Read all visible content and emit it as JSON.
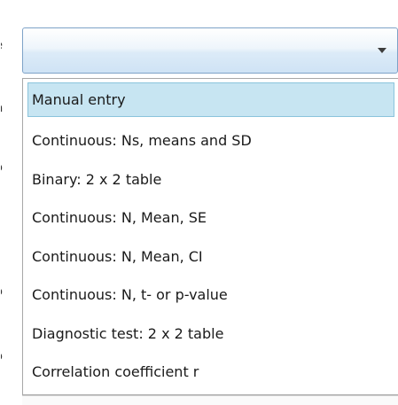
{
  "left_labels": [
    "e",
    "n",
    "o",
    "r",
    "o",
    "o"
  ],
  "combo": {
    "value": ""
  },
  "dropdown": {
    "options": [
      "Manual entry",
      "Continuous: Ns, means and SD",
      "Binary: 2 x 2 table",
      "Continuous: N, Mean, SE",
      "Continuous: N, Mean, CI",
      "Continuous: N, t- or p-value",
      "Diagnostic test: 2 x 2 table",
      "Correlation coefficient r"
    ],
    "selected_index": 0
  },
  "colors": {
    "highlight": "#c7e5f2",
    "highlight_border": "#8bc4dc",
    "combo_border": "#7ea3c8"
  },
  "icons": {
    "combo_arrow": "caret-down-icon"
  }
}
